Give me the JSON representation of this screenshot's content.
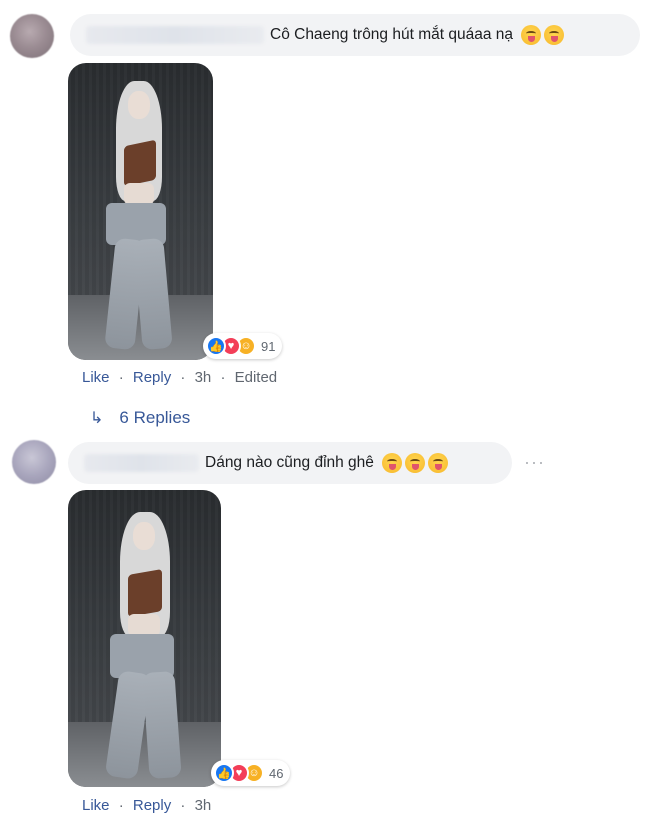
{
  "comments": [
    {
      "text": "Cô Chaeng trông hút mắt quáaa nạ",
      "emoji_icons": [
        "tongue-out-emoji",
        "tongue-out-emoji"
      ],
      "reaction_count": "91",
      "actions": {
        "like": "Like",
        "reply": "Reply",
        "time": "3h",
        "edited": "Edited"
      },
      "replies_label": "6 Replies"
    },
    {
      "text": "Dáng nào cũng đỉnh ghê",
      "emoji_icons": [
        "tongue-out-emoji",
        "tongue-out-emoji",
        "tongue-out-emoji"
      ],
      "reaction_count": "46",
      "actions": {
        "like": "Like",
        "reply": "Reply",
        "time": "3h"
      },
      "more_label": "···"
    }
  ],
  "separator": "·",
  "reaction_icons": [
    "like-reaction-icon",
    "love-reaction-icon",
    "care-reaction-icon"
  ],
  "colors": {
    "link": "#385898",
    "meta": "#606770",
    "bubble": "#f2f3f5",
    "like": "#1877f2",
    "love": "#f33e58",
    "care": "#f7b125"
  }
}
